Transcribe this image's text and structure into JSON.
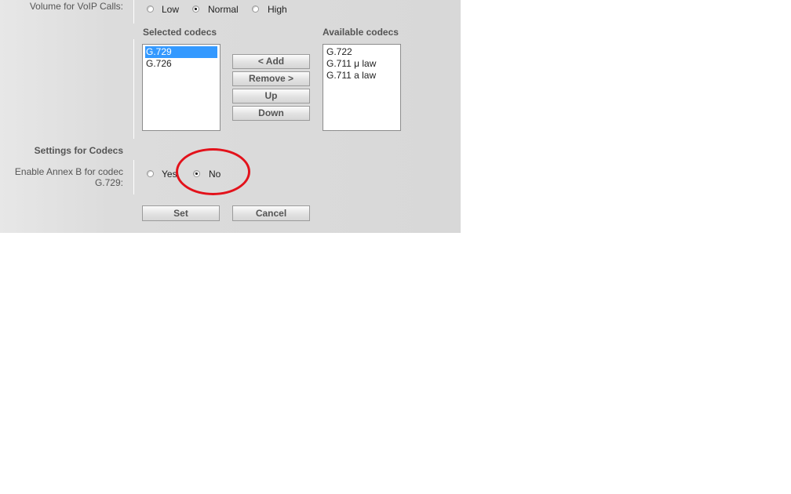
{
  "volume": {
    "label": "Volume for VoIP Calls:",
    "options": [
      "Low",
      "Normal",
      "High"
    ],
    "selected": "Normal"
  },
  "codecs": {
    "selected_header": "Selected codecs",
    "available_header": "Available codecs",
    "selected": [
      "G.729",
      "G.726"
    ],
    "selected_highlighted": "G.729",
    "available": [
      "G.722",
      "G.711 μ law",
      "G.711 a law"
    ],
    "buttons": {
      "add": "< Add",
      "remove": "Remove >",
      "up": "Up",
      "down": "Down"
    }
  },
  "codec_settings": {
    "header": "Settings for Codecs",
    "annex_b_label_line1": "Enable Annex B for codec",
    "annex_b_label_line2": "G.729:",
    "options": [
      "Yes",
      "No"
    ],
    "selected": "No"
  },
  "actions": {
    "set": "Set",
    "cancel": "Cancel"
  },
  "annotation": {
    "color": "#e3121b",
    "shape": "ellipse"
  }
}
